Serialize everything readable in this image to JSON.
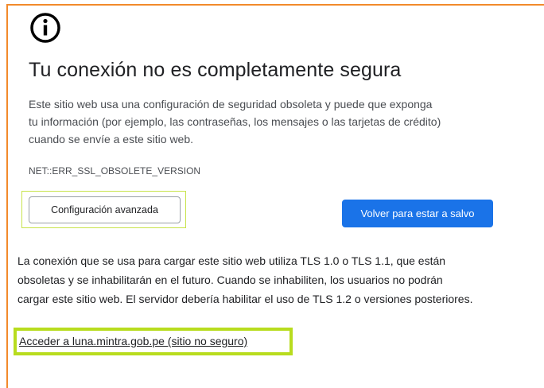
{
  "icon": "info-circle-icon",
  "colors": {
    "frame": "#f28a2b",
    "primary_button": "#1a73e8",
    "highlight": "#b8dc1e"
  },
  "interstitial": {
    "title": "Tu conexión no es completamente segura",
    "description_lines": [
      "Este sitio web usa una configuración de seguridad obsoleta y puede que exponga",
      "tu información (por ejemplo, las contraseñas, los mensajes o las tarjetas de crédito)",
      "cuando se envíe a este sitio web."
    ],
    "error_code": "NET::ERR_SSL_OBSOLETE_VERSION",
    "advanced_button": "Configuración avanzada",
    "back_to_safety_button": "Volver para estar a salvo",
    "tls_lines": [
      "La conexión que se usa para cargar este sitio web utiliza TLS 1.0 o TLS 1.1, que están",
      "obsoletas y se inhabilitarán en el futuro. Cuando se inhabiliten, los usuarios no podrán",
      "cargar este sitio web. El servidor debería habilitar el uso de TLS 1.2 o versiones posteriores."
    ],
    "proceed_link": "Acceder a luna.mintra.gob.pe (sitio no seguro)"
  }
}
